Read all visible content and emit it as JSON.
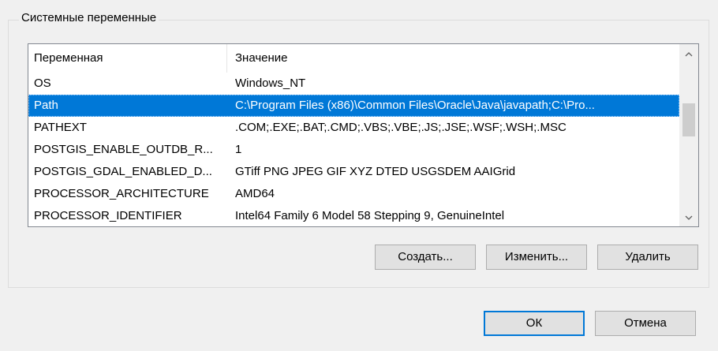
{
  "group": {
    "title": "Системные переменные"
  },
  "table": {
    "columns": [
      "Переменная",
      "Значение"
    ],
    "rows": [
      {
        "name": "OS",
        "value": "Windows_NT"
      },
      {
        "name": "Path",
        "value": "C:\\Program Files (x86)\\Common Files\\Oracle\\Java\\javapath;C:\\Pro...",
        "selected": true
      },
      {
        "name": "PATHEXT",
        "value": ".COM;.EXE;.BAT;.CMD;.VBS;.VBE;.JS;.JSE;.WSF;.WSH;.MSC"
      },
      {
        "name": "POSTGIS_ENABLE_OUTDB_R...",
        "value": "1"
      },
      {
        "name": "POSTGIS_GDAL_ENABLED_D...",
        "value": "GTiff PNG JPEG GIF XYZ DTED USGSDEM AAIGrid"
      },
      {
        "name": "PROCESSOR_ARCHITECTURE",
        "value": "AMD64"
      },
      {
        "name": "PROCESSOR_IDENTIFIER",
        "value": "Intel64 Family 6 Model 58 Stepping 9, GenuineIntel"
      }
    ]
  },
  "scrollbar": {
    "up_icon": "chevron-up-icon",
    "down_icon": "chevron-down-icon"
  },
  "buttons": {
    "create": "Создать...",
    "edit": "Изменить...",
    "delete": "Удалить",
    "ok": "ОК",
    "cancel": "Отмена"
  },
  "colors": {
    "selection": "#0078d7",
    "background": "#f0f0f0"
  }
}
